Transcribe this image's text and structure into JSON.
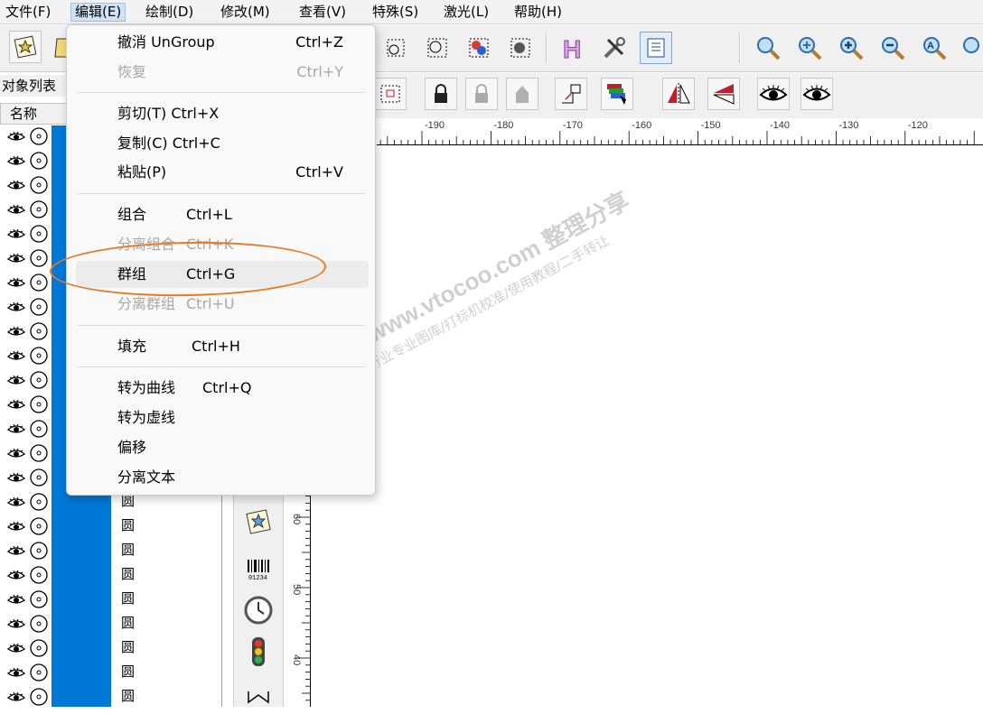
{
  "menubar": {
    "items": [
      "文件(F)",
      "编辑(E)",
      "绘制(D)",
      "修改(M)",
      "查看(V)",
      "特殊(S)",
      "激光(L)",
      "帮助(H)"
    ],
    "active_index": 1
  },
  "object_panel": {
    "title": "对象列表",
    "column_name": "名称",
    "row_label": "圆"
  },
  "edit_menu": {
    "undo": {
      "label": "撤消 UnGroup",
      "shortcut": "Ctrl+Z"
    },
    "redo": {
      "label": "恢复",
      "shortcut": "Ctrl+Y"
    },
    "cut": {
      "label": "剪切(T) Ctrl+X"
    },
    "copy": {
      "label": "复制(C) Ctrl+C"
    },
    "paste": {
      "label": "粘贴(P)",
      "shortcut": "Ctrl+V"
    },
    "combine": {
      "label": "组合",
      "shortcut": "Ctrl+L"
    },
    "uncombine": {
      "label": "分离组合",
      "shortcut": "Ctrl+K"
    },
    "group": {
      "label": "群组",
      "shortcut": "Ctrl+G"
    },
    "ungroup": {
      "label": "分离群组",
      "shortcut": "Ctrl+U"
    },
    "fill": {
      "label": "填充",
      "shortcut": "Ctrl+H"
    },
    "to_curve": {
      "label": "转为曲线",
      "shortcut": "Ctrl+Q"
    },
    "to_dashed": {
      "label": "转为虚线"
    },
    "offset": {
      "label": "偏移"
    },
    "split_text": {
      "label": "分离文本"
    }
  },
  "rulers": {
    "horizontal": [
      "-190",
      "-180",
      "-170",
      "-160",
      "-150",
      "-140",
      "-130",
      "-120"
    ],
    "vertical": [
      "60",
      "50",
      "40"
    ]
  },
  "watermark": {
    "line1": "微图库- www.vtocoo.com 整理分享",
    "line2": "激光打标行业专业图库/打标机校准/使用教程/二手转让"
  },
  "colors": {
    "selection_blue": "#0078d7",
    "annotation_orange": "#e87b22"
  },
  "icons": [
    "star-tool-icon",
    "select-nodes-icon",
    "color-fill-icon",
    "hatch-icon",
    "tools-icon",
    "properties-icon",
    "zoom-icon",
    "zoom-in-icon",
    "zoom-out-icon",
    "lock-icon",
    "unlock-icon",
    "mirror-icon",
    "eye-icon",
    "barcode-icon",
    "clock-icon",
    "traffic-light-icon"
  ]
}
